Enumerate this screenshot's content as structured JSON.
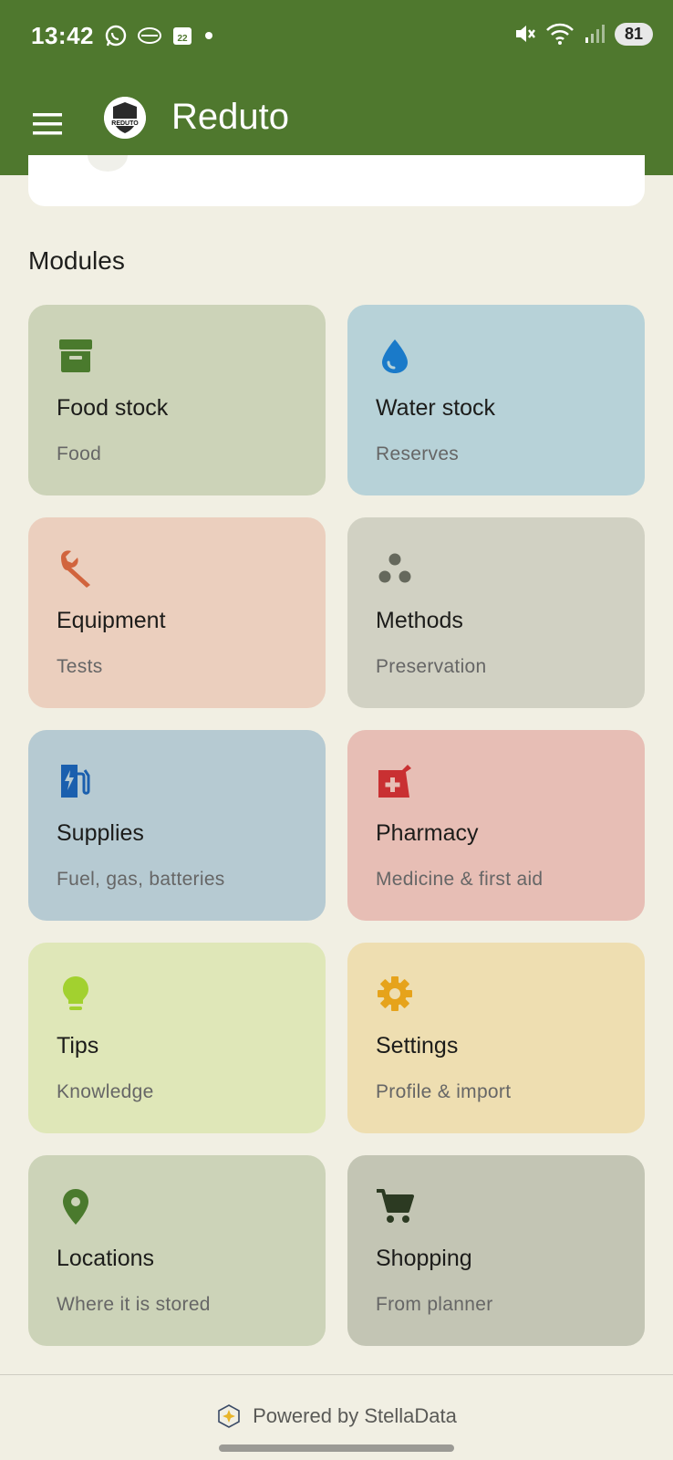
{
  "status_bar": {
    "time": "13:42",
    "battery": "81",
    "calendar_day": "22"
  },
  "app_bar": {
    "title": "Reduto",
    "logo_text": "REDUTO"
  },
  "modules": {
    "heading": "Modules",
    "items": [
      {
        "title": "Food stock",
        "subtitle": "Food",
        "icon": "archive-icon",
        "bg": "#ccd3b8",
        "icon_color": "#4a7a2d"
      },
      {
        "title": "Water stock",
        "subtitle": "Reserves",
        "icon": "water-drop-icon",
        "bg": "#b7d2d8",
        "icon_color": "#1a7ac9"
      },
      {
        "title": "Equipment",
        "subtitle": "Tests",
        "icon": "wrench-icon",
        "bg": "#ebcfbe",
        "icon_color": "#d1643d"
      },
      {
        "title": "Methods",
        "subtitle": "Preservation",
        "icon": "dots-cluster-icon",
        "bg": "#d1d1c3",
        "icon_color": "#65685c"
      },
      {
        "title": "Supplies",
        "subtitle": "Fuel, gas, batteries",
        "icon": "ev-station-icon",
        "bg": "#b6cad2",
        "icon_color": "#1a5fae"
      },
      {
        "title": "Pharmacy",
        "subtitle": "Medicine & first aid",
        "icon": "pharmacy-icon",
        "bg": "#e7beb5",
        "icon_color": "#c93032"
      },
      {
        "title": "Tips",
        "subtitle": "Knowledge",
        "icon": "lightbulb-icon",
        "bg": "#dfe7b8",
        "icon_color": "#a2d12f"
      },
      {
        "title": "Settings",
        "subtitle": "Profile & import",
        "icon": "gear-icon",
        "bg": "#eedeb1",
        "icon_color": "#e6a31b"
      },
      {
        "title": "Locations",
        "subtitle": "Where it is stored",
        "icon": "map-pin-icon",
        "bg": "#ccd3b8",
        "icon_color": "#4a7a2d"
      },
      {
        "title": "Shopping",
        "subtitle": "From planner",
        "icon": "cart-icon",
        "bg": "#c3c5b4",
        "icon_color": "#2c3a22"
      }
    ]
  },
  "footer": {
    "text": "Powered by StellaData"
  },
  "colors": {
    "brand": "#4f782e",
    "background": "#f1efe3"
  }
}
